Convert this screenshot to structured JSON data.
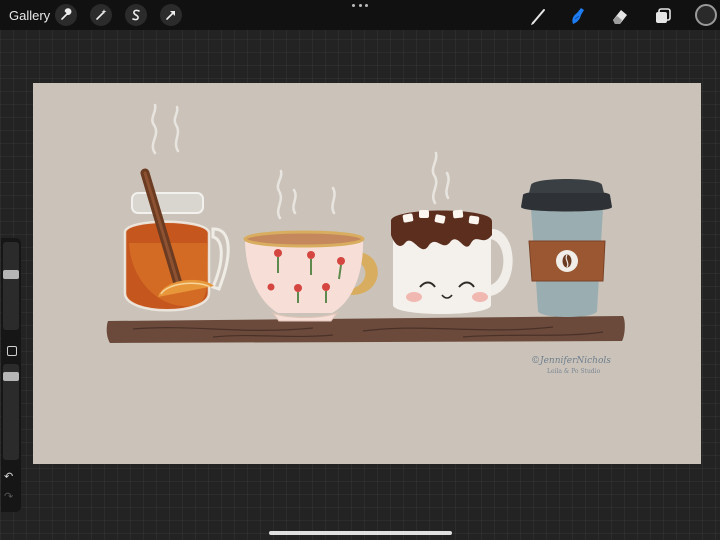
{
  "toolbar": {
    "gallery_label": "Gallery",
    "left_tools": [
      "wrench-icon",
      "magic-wand-icon",
      "selection-icon",
      "transform-arrow-icon"
    ],
    "right_tools": [
      "brush-icon",
      "smudge-icon",
      "eraser-icon",
      "layers-icon"
    ],
    "active_tool": "smudge-icon",
    "active_color": "#1e7cf2",
    "current_color": "#2a2a2a"
  },
  "artwork": {
    "signature": "©JenniferNichols",
    "studio": "Leila & Po Studio",
    "background_color": "#cbc3b9"
  },
  "sidebar": {
    "brush_size_level": 0.15,
    "opacity_level": 0.2,
    "undo_icon": "undo-icon",
    "redo_icon": "redo-icon"
  }
}
